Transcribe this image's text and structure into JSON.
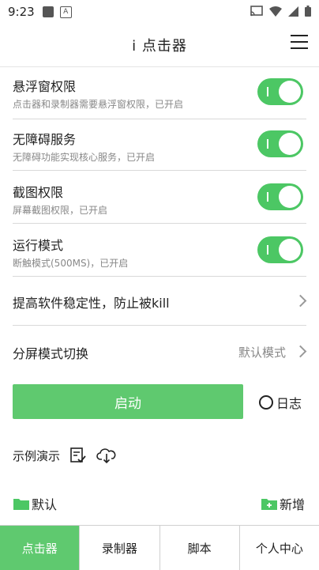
{
  "status_bar": {
    "time": "9:23"
  },
  "app_bar": {
    "title": "i 点击器"
  },
  "settings": [
    {
      "title": "悬浮窗权限",
      "subtitle": "点击器和录制器需要悬浮窗权限，已开启",
      "enabled": true
    },
    {
      "title": "无障碍服务",
      "subtitle": "无障碍功能实现核心服务，已开启",
      "enabled": true
    },
    {
      "title": "截图权限",
      "subtitle": "屏幕截图权限，已开启",
      "enabled": true
    },
    {
      "title": "运行模式",
      "subtitle": "断触模式(500MS)，已开启",
      "enabled": true
    }
  ],
  "stability": {
    "label": "提高软件稳定性，防止被kill"
  },
  "split_screen": {
    "label": "分屏模式切换",
    "value": "默认模式"
  },
  "start_button": {
    "label": "启动"
  },
  "log": {
    "label": "日志"
  },
  "demo": {
    "label": "示例演示"
  },
  "folders": {
    "default_label": "默认",
    "add_label": "新增"
  },
  "tabs": [
    "点击器",
    "录制器",
    "脚本",
    "个人中心"
  ],
  "colors": {
    "accent": "#5fc96f",
    "toggle": "#4cc764"
  }
}
